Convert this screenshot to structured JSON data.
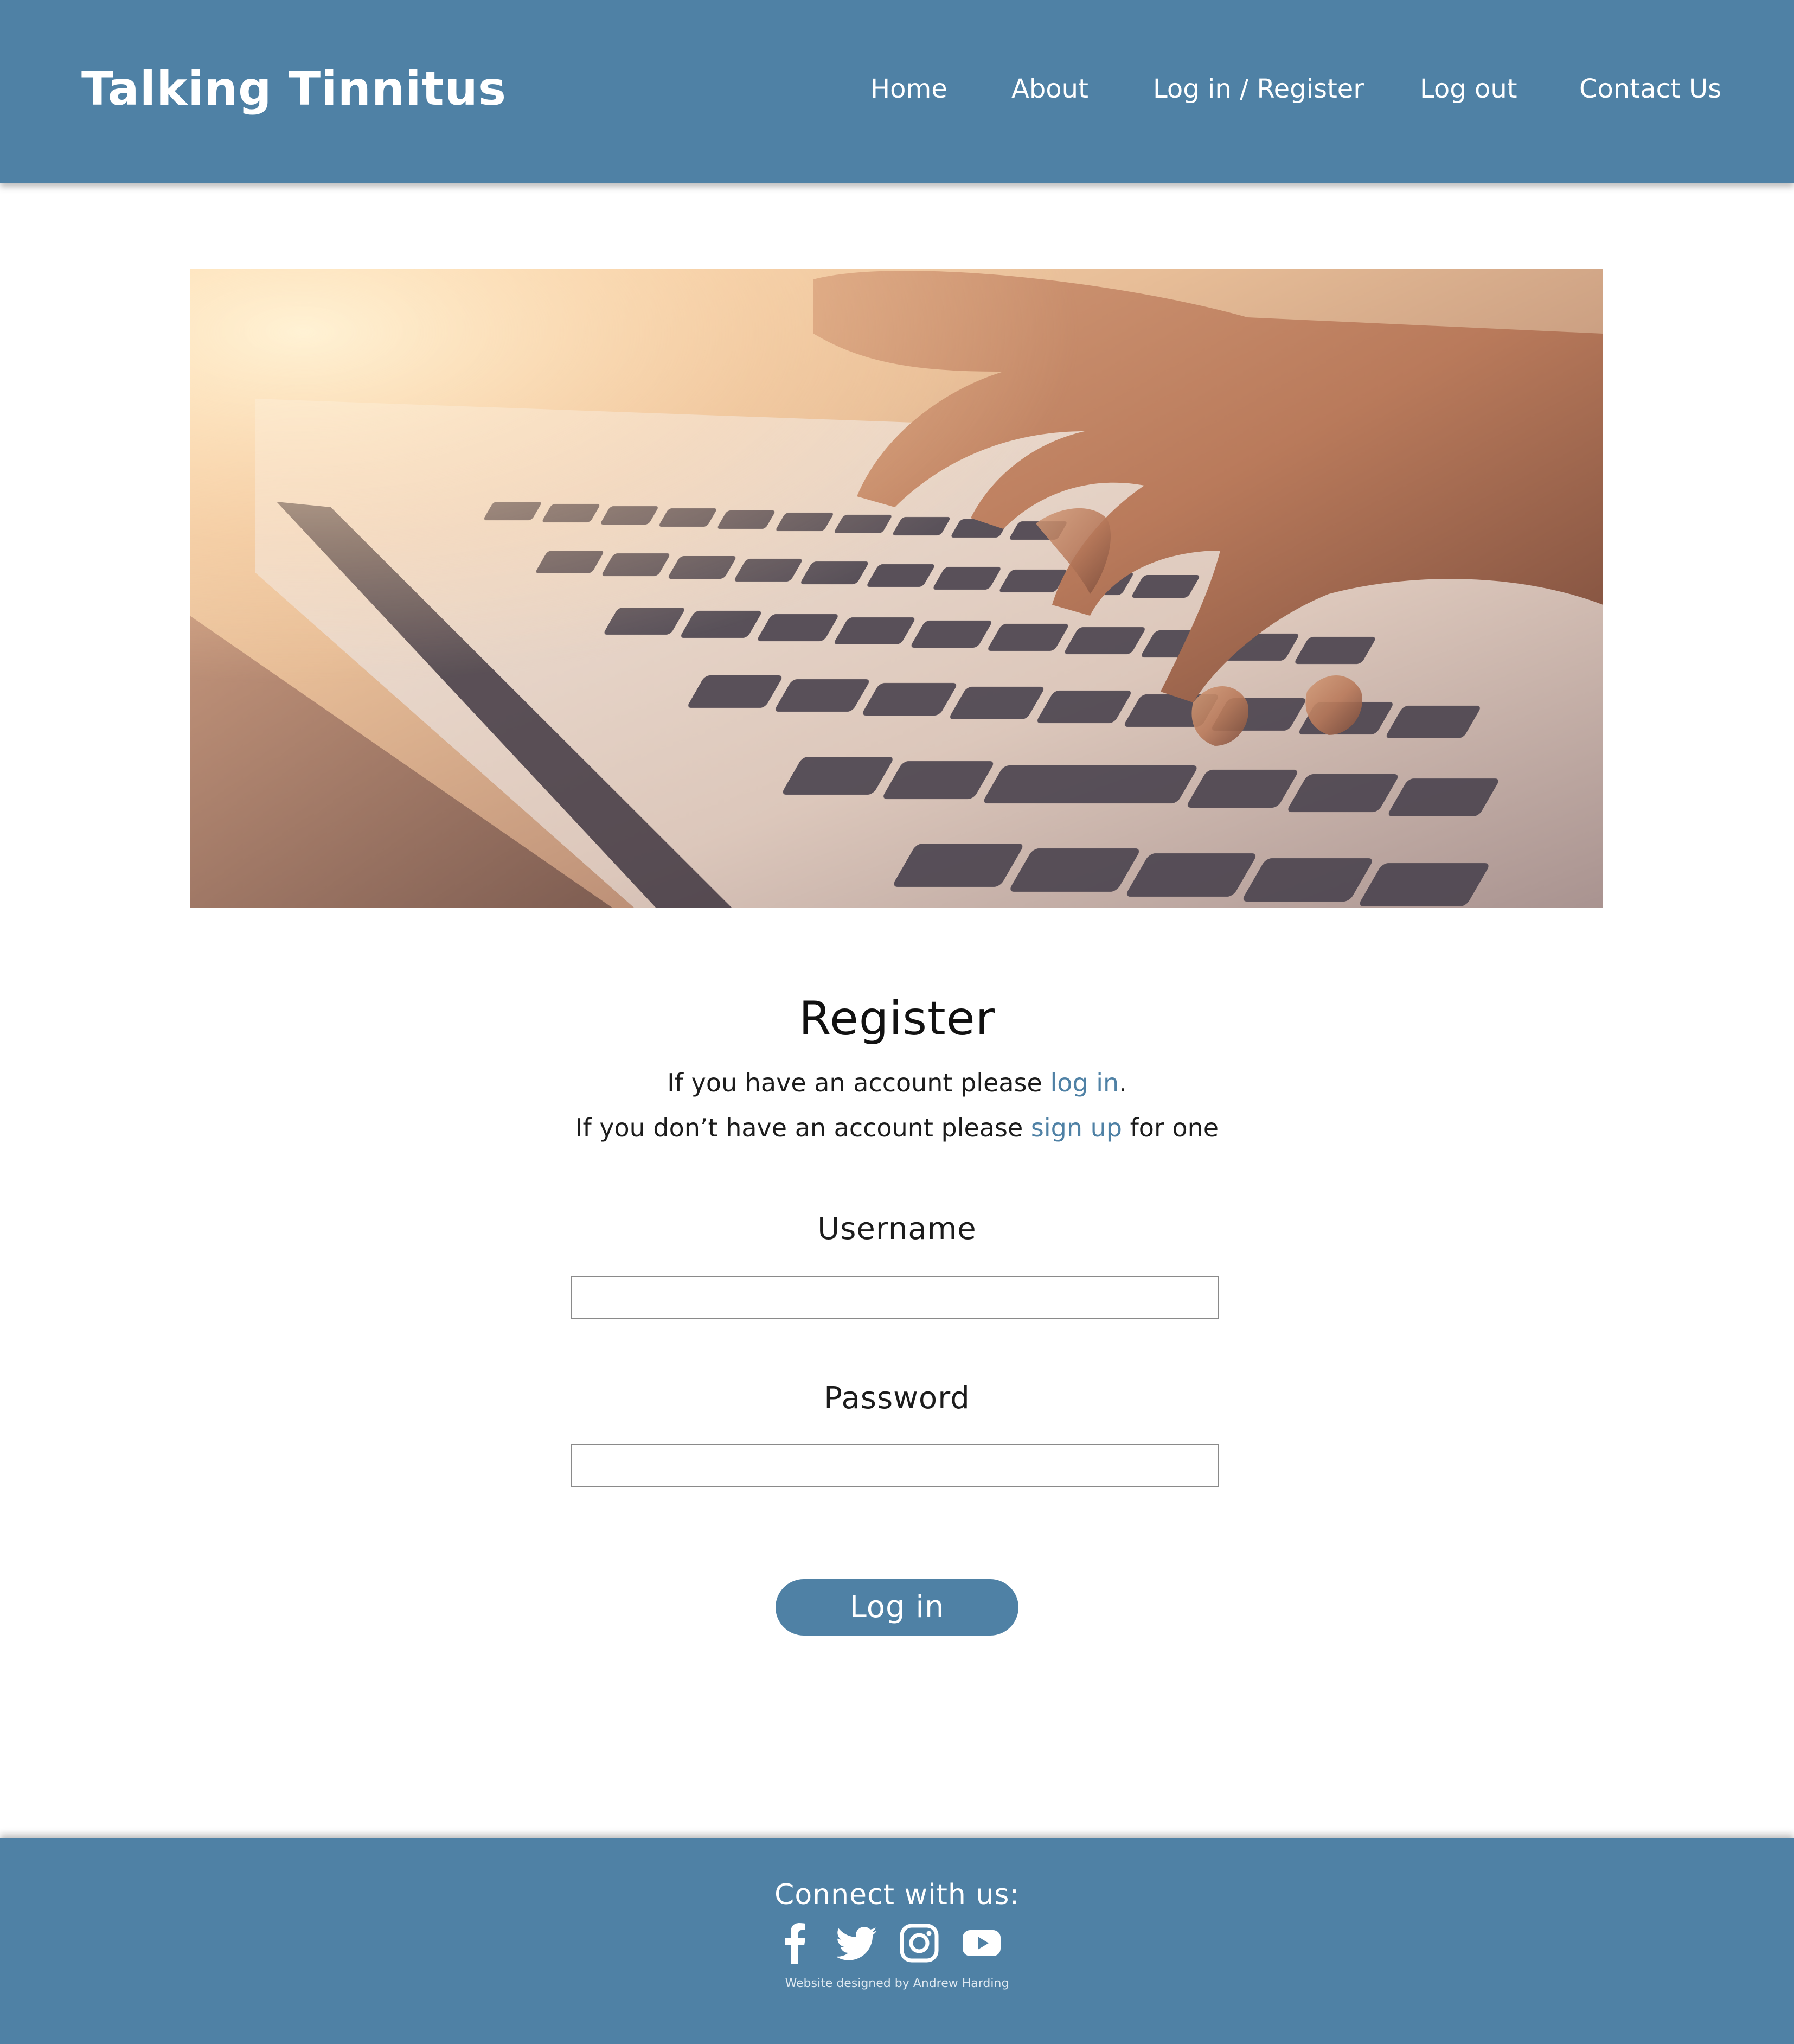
{
  "header": {
    "brand": "Talking Tinnitus",
    "nav": [
      {
        "label": "Home"
      },
      {
        "label": "About"
      },
      {
        "label": "Log in / Register"
      },
      {
        "label": "Log out"
      },
      {
        "label": "Contact Us"
      }
    ]
  },
  "hero": {
    "image_icon": "laptop-typing-photo"
  },
  "register": {
    "title": "Register",
    "line1_prefix": "If you have an account please ",
    "line1_link": "log in",
    "line1_suffix": ".",
    "line2_prefix": "If you don’t have an account please ",
    "line2_link": "sign up",
    "line2_suffix": " for one",
    "username_label": "Username",
    "username_value": "",
    "password_label": "Password",
    "password_value": "",
    "submit_label": "Log in"
  },
  "footer": {
    "connect": "Connect with us:",
    "social": [
      {
        "icon": "facebook-icon"
      },
      {
        "icon": "twitter-icon"
      },
      {
        "icon": "instagram-icon"
      },
      {
        "icon": "youtube-icon"
      }
    ],
    "credit": "Website designed by Andrew Harding"
  },
  "colors": {
    "brand": "#4f81a5",
    "background": "#ffffff",
    "text": "#1c1c1c",
    "link": "#4f81a5"
  }
}
